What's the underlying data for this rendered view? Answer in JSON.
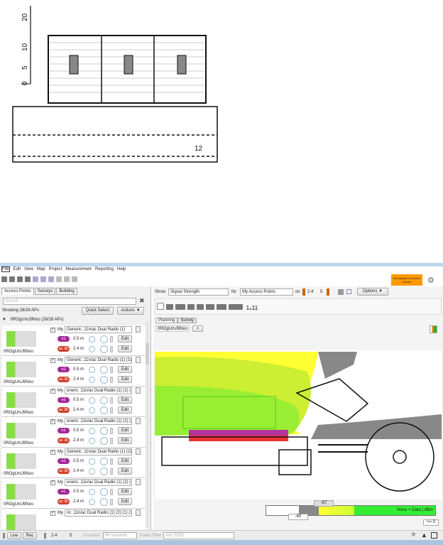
{
  "floorplan": {
    "scale_labels": [
      "20",
      "10",
      "5",
      "0"
    ],
    "room_label": "12"
  },
  "menu": [
    "File",
    "Edit",
    "View",
    "Map",
    "Project",
    "Measurement",
    "Reporting",
    "Help"
  ],
  "adapter_notice": "No Adapter for Active Survey",
  "left_tabs": [
    "Access Points",
    "Surveys",
    "Building"
  ],
  "search_placeholder": "Search",
  "showing": "Showing 28/28 APs",
  "quick_select": "Quick Select",
  "actions": "Actions ▼",
  "group": "0ROgUmJ9Nxo (28/28 APs)",
  "aps": [
    {
      "name": "Generic .11n/ac Dual Radio (1)",
      "floor": "0ROgUmJ9Nxo",
      "my": "My",
      "r1": "n1",
      "h1": "0.5 m",
      "r2": "ac 36",
      "h2": "2.4 m",
      "edit": "Edit"
    },
    {
      "name": "Generic .11n/ac Dual Radio (1) (1)",
      "floor": "0ROgUmJ9Nxo",
      "my": "My",
      "r1": "n1",
      "h1": "0.5 m",
      "r2": "ac 36",
      "h2": "2.4 m",
      "edit": "Edit"
    },
    {
      "name": "eneric .11n/ac Dual Radio (1) (1) (1)",
      "floor": "0ROgUmJ9Nxo",
      "my": "My",
      "r1": "n1",
      "h1": "0.5 m",
      "r2": "ac 36",
      "h2": "2.4 m",
      "edit": "Edit"
    },
    {
      "name": "eneric .11n/ac Dual Radio (1) (1) (2)",
      "floor": "0ROgUmJ9Nxo",
      "my": "My",
      "r1": "n1",
      "h1": "0.5 m",
      "r2": "ac 36",
      "h2": "2.4 m",
      "edit": "Edit"
    },
    {
      "name": "Generic .11n/ac Dual Radio (1) (2)",
      "floor": "0ROgUmJ9Nxo",
      "my": "My",
      "r1": "n1",
      "h1": "0.5 m",
      "r2": "ac 36",
      "h2": "2.4 m",
      "edit": "Edit"
    },
    {
      "name": "eneric .11n/ac Dual Radio (1) (2) (1)",
      "floor": "0ROgUmJ9Nxo",
      "my": "My",
      "r1": "n1",
      "h1": "0.5 m",
      "r2": "ac 36",
      "h2": "2.4 m",
      "edit": "Edit"
    },
    {
      "name": "ric .11n/ac Dual Radio (1) (2) (1) (1)",
      "floor": "",
      "my": "My",
      "r1": "",
      "h1": "",
      "r2": "",
      "h2": "",
      "edit": ""
    }
  ],
  "show_label": "Show",
  "show_value": "Signal Strength",
  "for_label": "for",
  "for_value": "My Access Points",
  "on_label": "on",
  "band1": "2.4",
  "band2": "5",
  "options": "Options ▼",
  "zoom_label": "1₆11",
  "view_tabs": [
    "Planning",
    "Survey"
  ],
  "floor_select": "0ROgUmJ9Nxo",
  "floor_btn": "+",
  "legend": {
    "top": "-67",
    "left": "-80",
    "right": ">= 0",
    "caption": "Voice + Data | dBm",
    "colors": [
      "#ffffff",
      "#888888",
      "#ffff33",
      "#ccff33",
      "#33ee33"
    ]
  },
  "status": {
    "live": "Live",
    "rec": "Rec",
    "b1": "2.4",
    "b2": "5",
    "duration_label": "Duration",
    "duration": "60 seconds",
    "radio_label": "Radio Filter",
    "radio": "Any SSID"
  }
}
